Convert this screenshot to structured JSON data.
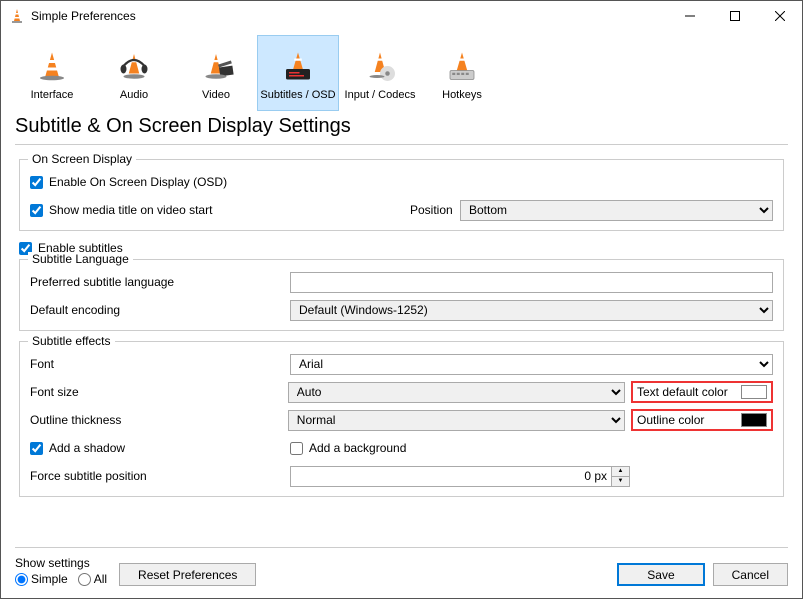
{
  "window": {
    "title": "Simple Preferences"
  },
  "tabs": {
    "interface": "Interface",
    "audio": "Audio",
    "video": "Video",
    "subtitles": "Subtitles / OSD",
    "input_codecs": "Input / Codecs",
    "hotkeys": "Hotkeys"
  },
  "heading": "Subtitle & On Screen Display Settings",
  "osd": {
    "group_title": "On Screen Display",
    "enable": "Enable On Screen Display (OSD)",
    "show_title": "Show media title on video start",
    "position_label": "Position",
    "position_value": "Bottom"
  },
  "enable_subtitles": "Enable subtitles",
  "lang": {
    "group_title": "Subtitle Language",
    "preferred_label": "Preferred subtitle language",
    "preferred_value": "",
    "encoding_label": "Default encoding",
    "encoding_value": "Default (Windows-1252)"
  },
  "effects": {
    "group_title": "Subtitle effects",
    "font_label": "Font",
    "font_value": "Arial",
    "fontsize_label": "Font size",
    "fontsize_value": "Auto",
    "text_color_label": "Text default color",
    "outline_thick_label": "Outline thickness",
    "outline_thick_value": "Normal",
    "outline_color_label": "Outline color",
    "add_shadow": "Add a shadow",
    "add_background": "Add a background",
    "force_pos_label": "Force subtitle position",
    "force_pos_value": "0 px"
  },
  "footer": {
    "show_settings": "Show settings",
    "simple": "Simple",
    "all": "All",
    "reset": "Reset Preferences",
    "save": "Save",
    "cancel": "Cancel"
  }
}
